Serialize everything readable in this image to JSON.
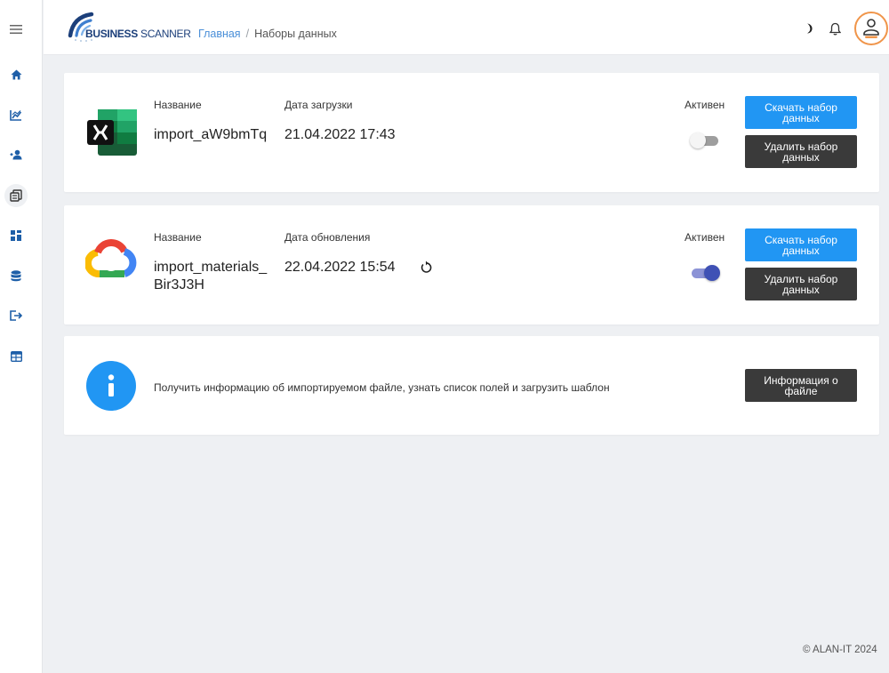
{
  "header": {
    "logo_bold": "BUSINESS",
    "logo_light": " SCANNER",
    "breadcrumb": [
      "Главная",
      "Наборы данных"
    ]
  },
  "datasets": [
    {
      "name_label": "Название",
      "name": "import_aW9bmTq",
      "date_label": "Дата загрузки",
      "date": "21.04.2022 17:43",
      "active_label": "Активен",
      "active": false,
      "icon": "excel-icon",
      "download_label": "Скачать набор данных",
      "delete_label": "Удалить набор данных"
    },
    {
      "name_label": "Название",
      "name": "import_materials_Bir3J3H",
      "date_label": "Дата обновления",
      "date": "22.04.2022 15:54",
      "active_label": "Активен",
      "active": true,
      "icon": "google-cloud-icon",
      "download_label": "Скачать набор данных",
      "delete_label": "Удалить набор данных"
    }
  ],
  "info": {
    "text": "Получить информацию об импортируемом файле, узнать список полей и загрузить шаблон",
    "button_label": "Информация о файле"
  },
  "footer": "© ALAN-IT 2024",
  "colors": {
    "primary": "#2196f3",
    "dark_button": "#3a3a3a",
    "toggle_on": "#3f51b5",
    "sidebar_icon": "#1e5fa8"
  }
}
